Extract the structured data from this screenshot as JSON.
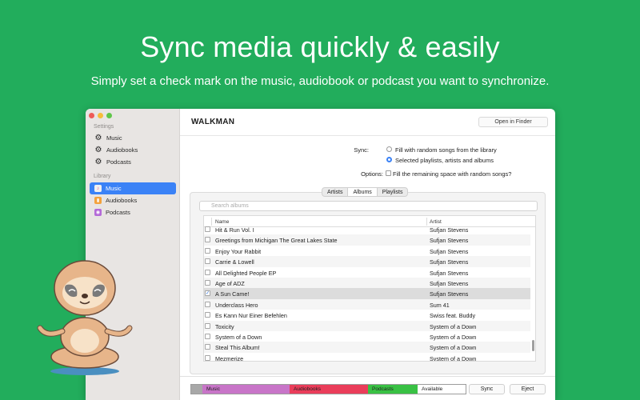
{
  "hero": {
    "headline": "Sync media quickly & easily",
    "subline": "Simply set a check mark on the music, audiobook or podcast you want to synchronize."
  },
  "sidebar": {
    "settings_header": "Settings",
    "settings_items": [
      {
        "label": "Music",
        "icon": "gear-icon"
      },
      {
        "label": "Audiobooks",
        "icon": "gear-icon"
      },
      {
        "label": "Podcasts",
        "icon": "gear-icon"
      }
    ],
    "library_header": "Library",
    "library_items": [
      {
        "label": "Music",
        "icon": "music-app-icon",
        "selected": true
      },
      {
        "label": "Audiobooks",
        "icon": "books-app-icon",
        "selected": false
      },
      {
        "label": "Podcasts",
        "icon": "podcasts-app-icon",
        "selected": false
      }
    ]
  },
  "main": {
    "title": "WALKMAN",
    "open_in_finder": "Open in Finder",
    "sync_label": "Sync:",
    "sync_option_1": "Fill with random songs from the library",
    "sync_option_2": "Selected playlists, artists and albums",
    "sync_selected": 2,
    "options_label": "Options:",
    "options_fill": "Fill the remaining space with random songs?",
    "options_fill_checked": false,
    "tabs": [
      "Artists",
      "Albums",
      "Playlists"
    ],
    "active_tab": "Albums",
    "search_placeholder": "Search albums",
    "columns": {
      "name": "Name",
      "artist": "Artist"
    },
    "rows": [
      {
        "name": "Hit & Run Vol. I",
        "artist": "Sufjan Stevens",
        "checked": false
      },
      {
        "name": "Greetings from Michigan The Great Lakes State",
        "artist": "Sufjan Stevens",
        "checked": false
      },
      {
        "name": "Enjoy Your Rabbit",
        "artist": "Sufjan Stevens",
        "checked": false
      },
      {
        "name": "Carrie & Lowell",
        "artist": "Sufjan Stevens",
        "checked": false
      },
      {
        "name": "All Delighted People EP",
        "artist": "Sufjan Stevens",
        "checked": false
      },
      {
        "name": "Age of ADZ",
        "artist": "Sufjan Stevens",
        "checked": false
      },
      {
        "name": "A Sun Came!",
        "artist": "Sufjan Stevens",
        "checked": true
      },
      {
        "name": "Underclass Hero",
        "artist": "Sum 41",
        "checked": false
      },
      {
        "name": "Es Kann Nur Einer Befehlen",
        "artist": "Swiss  feat. Buddy",
        "checked": false
      },
      {
        "name": "Toxicity",
        "artist": "System of a Down",
        "checked": false
      },
      {
        "name": "System of a Down",
        "artist": "System of a Down",
        "checked": false
      },
      {
        "name": "Steal This Album!",
        "artist": "System of a Down",
        "checked": false
      },
      {
        "name": "Mezmerize",
        "artist": "System of a Down",
        "checked": false
      }
    ]
  },
  "footer": {
    "storage": {
      "music_label": "Music",
      "audiobooks_label": "Audiobooks",
      "podcasts_label": "Podcasts",
      "available_label": "Available"
    },
    "sync_button": "Sync",
    "eject_button": "Eject"
  },
  "colors": {
    "background": "#22ad5c",
    "accent": "#3b82f6",
    "music": "#c875c8",
    "audiobooks": "#ea3d5a",
    "podcasts": "#39c144"
  }
}
